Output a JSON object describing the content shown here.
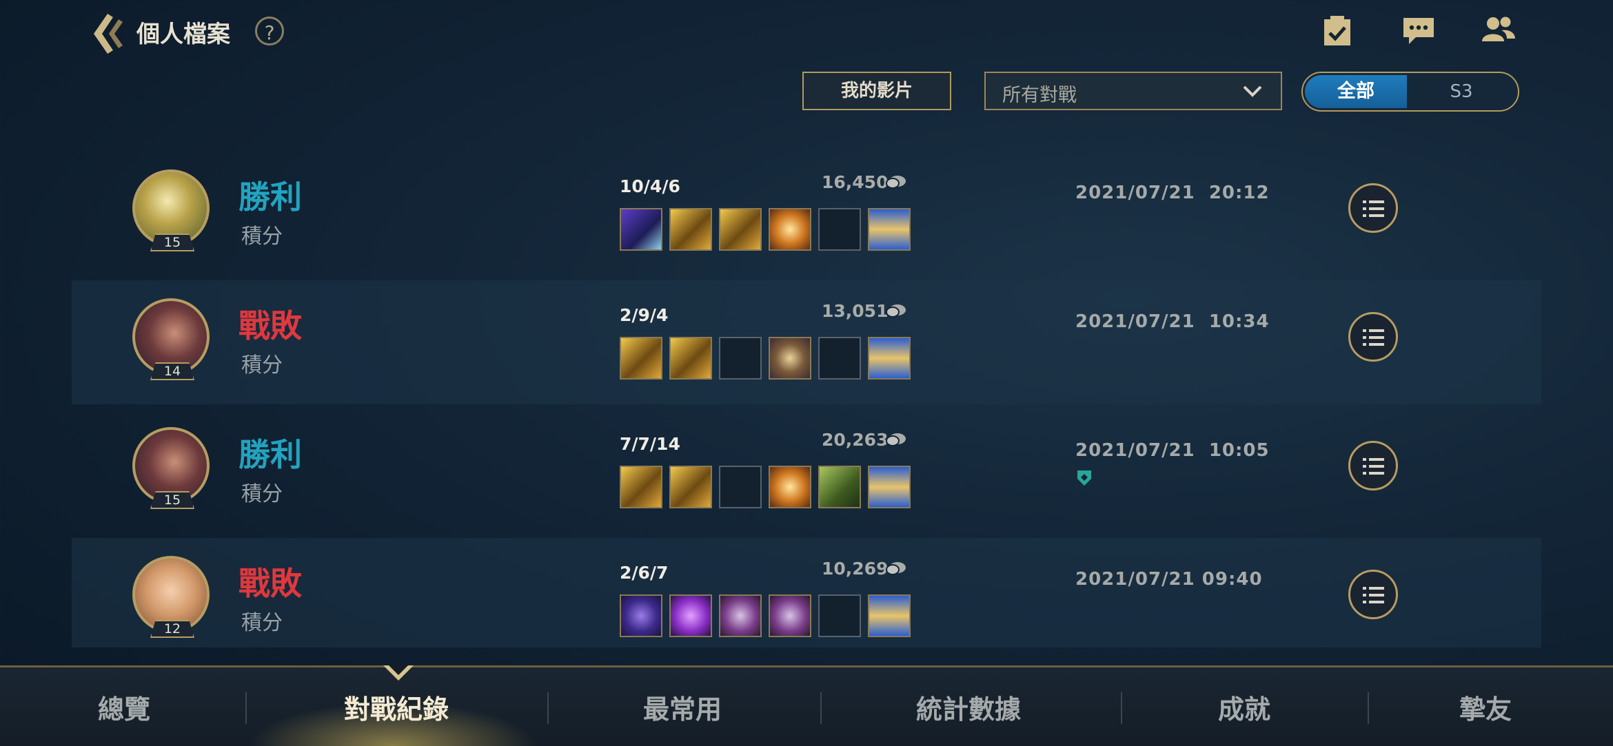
{
  "header": {
    "title": "個人檔案",
    "help": "?"
  },
  "filters": {
    "my_videos": "我的影片",
    "match_filter": "所有對戰",
    "segment": {
      "all": "全部",
      "season": "S3"
    }
  },
  "matches": [
    {
      "result": "勝利",
      "result_type": "win",
      "mode": "積分",
      "level": "15",
      "kda": "10/4/6",
      "gold": "16,450",
      "date": "2021/07/21  20:12",
      "champion": "yellow-champion",
      "items": [
        "violet-blade",
        "gold-sword",
        "gold-sword",
        "gold-wings",
        "empty",
        "hourglass"
      ]
    },
    {
      "result": "戰敗",
      "result_type": "lose",
      "mode": "積分",
      "level": "14",
      "kda": "2/9/4",
      "gold": "13,051",
      "date": "2021/07/21  10:34",
      "champion": "swordsman-champion",
      "items": [
        "gold-sword",
        "gold-sword",
        "empty",
        "mace",
        "empty",
        "hourglass"
      ]
    },
    {
      "result": "勝利",
      "result_type": "win",
      "mode": "積分",
      "level": "15",
      "kda": "7/7/14",
      "gold": "20,263",
      "date": "2021/07/21  10:05",
      "champion": "swordsman-champion",
      "items": [
        "gold-sword",
        "gold-sword",
        "empty",
        "gold-wings",
        "green-claw",
        "hourglass"
      ]
    },
    {
      "result": "戰敗",
      "result_type": "lose",
      "mode": "積分",
      "level": "12",
      "kda": "2/6/7",
      "gold": "10,269",
      "date": "2021/07/21 09:40",
      "champion": "female-champion",
      "items": [
        "violet-orb",
        "violet-book",
        "violet-pendant",
        "violet-pendant",
        "empty",
        "hourglass"
      ]
    }
  ],
  "tabs": [
    {
      "label": "總覽"
    },
    {
      "label": "對戰紀錄",
      "active": true
    },
    {
      "label": "最常用"
    },
    {
      "label": "統計數據"
    },
    {
      "label": "成就"
    },
    {
      "label": "摯友"
    }
  ],
  "colors": {
    "win": "#22a3bf",
    "lose": "#e0383d",
    "gold_border": "#b79d62",
    "accent_blue": "#1f7dbd"
  }
}
